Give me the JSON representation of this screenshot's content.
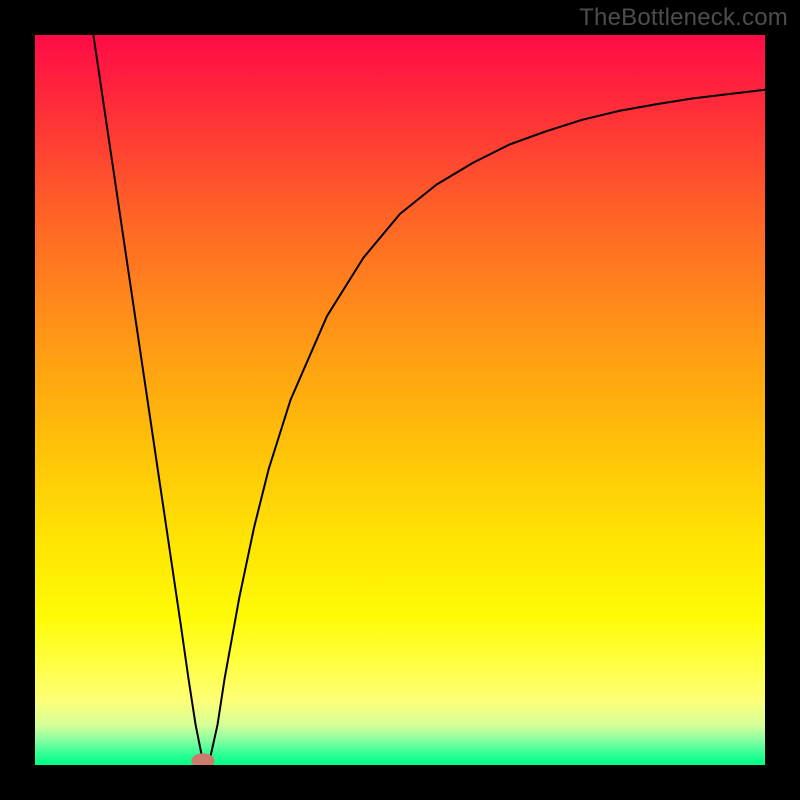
{
  "watermark": {
    "text": "TheBottleneck.com"
  },
  "chart_data": {
    "type": "line",
    "title": "",
    "xlabel": "",
    "ylabel": "",
    "xlim": [
      0,
      100
    ],
    "ylim": [
      0,
      100
    ],
    "grid": false,
    "legend": false,
    "annotations": [],
    "background_gradient_stops": [
      {
        "pos": 0.0,
        "color": "#ff0b46"
      },
      {
        "pos": 0.1,
        "color": "#ff2d39"
      },
      {
        "pos": 0.25,
        "color": "#ff6426"
      },
      {
        "pos": 0.4,
        "color": "#ff9317"
      },
      {
        "pos": 0.55,
        "color": "#ffbe09"
      },
      {
        "pos": 0.7,
        "color": "#ffe603"
      },
      {
        "pos": 0.8,
        "color": "#fffb07"
      },
      {
        "pos": 0.86,
        "color": "#feff40"
      },
      {
        "pos": 0.91,
        "color": "#feff75"
      },
      {
        "pos": 0.945,
        "color": "#d6ff98"
      },
      {
        "pos": 0.965,
        "color": "#8bffa0"
      },
      {
        "pos": 0.985,
        "color": "#2fff95"
      },
      {
        "pos": 1.0,
        "color": "#00ff85"
      }
    ],
    "series": [
      {
        "name": "curve",
        "type": "line",
        "x": [
          8.0,
          10.0,
          12.0,
          14.0,
          16.0,
          18.0,
          20.0,
          21.0,
          22.0,
          23.0,
          24.0,
          25.0,
          26.0,
          28.0,
          30.0,
          32.0,
          35.0,
          40.0,
          45.0,
          50.0,
          55.0,
          60.0,
          65.0,
          70.0,
          75.0,
          80.0,
          85.0,
          90.0,
          95.0,
          100.0
        ],
        "y": [
          100.0,
          86.5,
          73.0,
          59.5,
          46.0,
          32.5,
          19.0,
          12.0,
          5.5,
          0.5,
          1.0,
          5.5,
          12.0,
          23.0,
          32.5,
          40.5,
          50.0,
          61.5,
          69.5,
          75.5,
          79.5,
          82.5,
          85.0,
          86.8,
          88.4,
          89.6,
          90.5,
          91.3,
          91.9,
          92.5
        ]
      }
    ],
    "marker": {
      "name": "vertex-marker",
      "cx": 23.0,
      "cy": 0.6,
      "rx": 1.6,
      "ry": 1.0,
      "fill": "#cc7b6d"
    }
  }
}
